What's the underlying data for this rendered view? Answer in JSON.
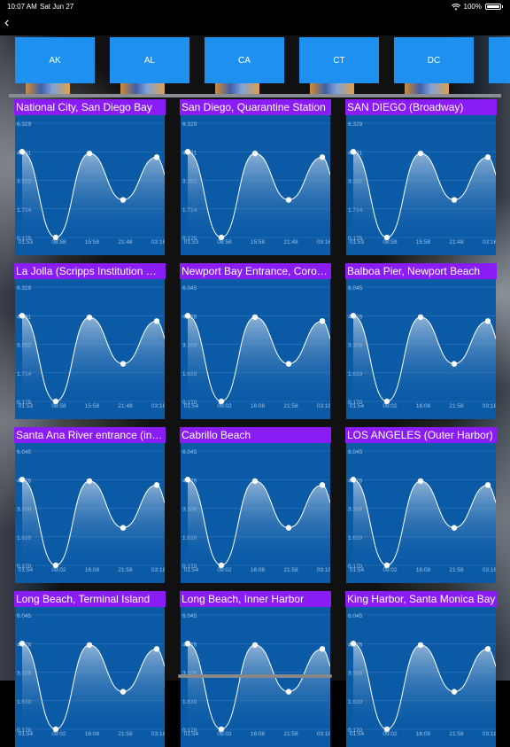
{
  "status": {
    "time": "10:07 AM",
    "date": "Sat Jun 27",
    "battery": "100%"
  },
  "nav": {
    "back_icon": "chevron-left-icon"
  },
  "states": [
    "AK",
    "AL",
    "CA",
    "CT",
    "DC"
  ],
  "stations": [
    {
      "name": "National City, San Diego Bay",
      "y_ticks": [
        "6.329",
        "4.791",
        "3.252",
        "1.714",
        "0.175"
      ],
      "x_ticks": [
        "01:53",
        "08:58",
        "15:58",
        "21:48",
        "03:16"
      ],
      "values": [
        4.791,
        0.175,
        4.7,
        2.2,
        4.5
      ]
    },
    {
      "name": "San Diego, Quarantine Station",
      "y_ticks": [
        "6.329",
        "4.791",
        "3.252",
        "1.714",
        "0.175"
      ],
      "x_ticks": [
        "01:53",
        "08:58",
        "15:58",
        "21:48",
        "03:16"
      ],
      "values": [
        4.791,
        0.175,
        4.7,
        2.2,
        4.5
      ]
    },
    {
      "name": "SAN DIEGO (Broadway)",
      "y_ticks": [
        "6.329",
        "4.791",
        "3.252",
        "1.714",
        "0.175"
      ],
      "x_ticks": [
        "01:53",
        "08:58",
        "15:58",
        "21:48",
        "03:16"
      ],
      "values": [
        4.791,
        0.175,
        4.7,
        2.2,
        4.5
      ]
    },
    {
      "name": "La Jolla (Scripps Institution Wharf)",
      "y_ticks": [
        "6.329",
        "4.791",
        "3.252",
        "1.714",
        "0.175"
      ],
      "x_ticks": [
        "01:53",
        "08:58",
        "15:58",
        "21:48",
        "03:16"
      ],
      "values": [
        4.791,
        0.175,
        4.7,
        2.2,
        4.5
      ]
    },
    {
      "name": "Newport Bay Entrance, Corona del Mar",
      "y_ticks": [
        "6.045",
        "4.576",
        "3.108",
        "1.639",
        "0.170"
      ],
      "x_ticks": [
        "01:54",
        "09:02",
        "16:08",
        "21:58",
        "03:18"
      ],
      "values": [
        4.576,
        0.17,
        4.5,
        2.1,
        4.3
      ]
    },
    {
      "name": "Balboa Pier, Newport Beach",
      "y_ticks": [
        "6.045",
        "4.576",
        "3.108",
        "1.639",
        "0.170"
      ],
      "x_ticks": [
        "01:54",
        "09:02",
        "16:08",
        "21:58",
        "03:18"
      ],
      "values": [
        4.576,
        0.17,
        4.5,
        2.1,
        4.3
      ]
    },
    {
      "name": "Santa Ana River entrance (inside)",
      "y_ticks": [
        "6.045",
        "4.576",
        "3.108",
        "1.639",
        "0.170"
      ],
      "x_ticks": [
        "01:54",
        "09:02",
        "16:08",
        "21:58",
        "03:18"
      ],
      "values": [
        4.576,
        0.17,
        4.5,
        2.1,
        4.3
      ]
    },
    {
      "name": "Cabrillo Beach",
      "y_ticks": [
        "6.045",
        "4.576",
        "3.108",
        "1.639",
        "0.170"
      ],
      "x_ticks": [
        "01:54",
        "09:02",
        "16:08",
        "21:58",
        "03:18"
      ],
      "values": [
        4.576,
        0.17,
        4.5,
        2.1,
        4.3
      ]
    },
    {
      "name": "LOS ANGELES (Outer Harbor)",
      "y_ticks": [
        "6.045",
        "4.576",
        "3.108",
        "1.639",
        "0.170"
      ],
      "x_ticks": [
        "01:54",
        "09:02",
        "16:08",
        "21:58",
        "03:18"
      ],
      "values": [
        4.576,
        0.17,
        4.5,
        2.1,
        4.3
      ]
    },
    {
      "name": "Long Beach, Terminal Island",
      "y_ticks": [
        "6.045",
        "4.576",
        "3.108",
        "1.639",
        "0.170"
      ],
      "x_ticks": [
        "01:54",
        "09:02",
        "16:08",
        "21:58",
        "03:18"
      ],
      "values": [
        4.576,
        0.17,
        4.5,
        2.1,
        4.3
      ]
    },
    {
      "name": "Long Beach, Inner Harbor",
      "y_ticks": [
        "6.045",
        "4.576",
        "3.108",
        "1.639",
        "0.170"
      ],
      "x_ticks": [
        "01:54",
        "09:02",
        "16:08",
        "21:58",
        "03:18"
      ],
      "values": [
        4.576,
        0.17,
        4.5,
        2.1,
        4.3
      ]
    },
    {
      "name": "King Harbor, Santa Monica Bay",
      "y_ticks": [
        "6.045",
        "4.576",
        "3.108",
        "1.639",
        "0.170"
      ],
      "x_ticks": [
        "01:54",
        "09:02",
        "16:08",
        "21:58",
        "03:18"
      ],
      "values": [
        4.576,
        0.17,
        4.5,
        2.1,
        4.3
      ]
    }
  ],
  "colors": {
    "chart_bg": "#0a5aa6",
    "title_bg": "#8a1cf6",
    "state_btn": "#1e90f0"
  }
}
